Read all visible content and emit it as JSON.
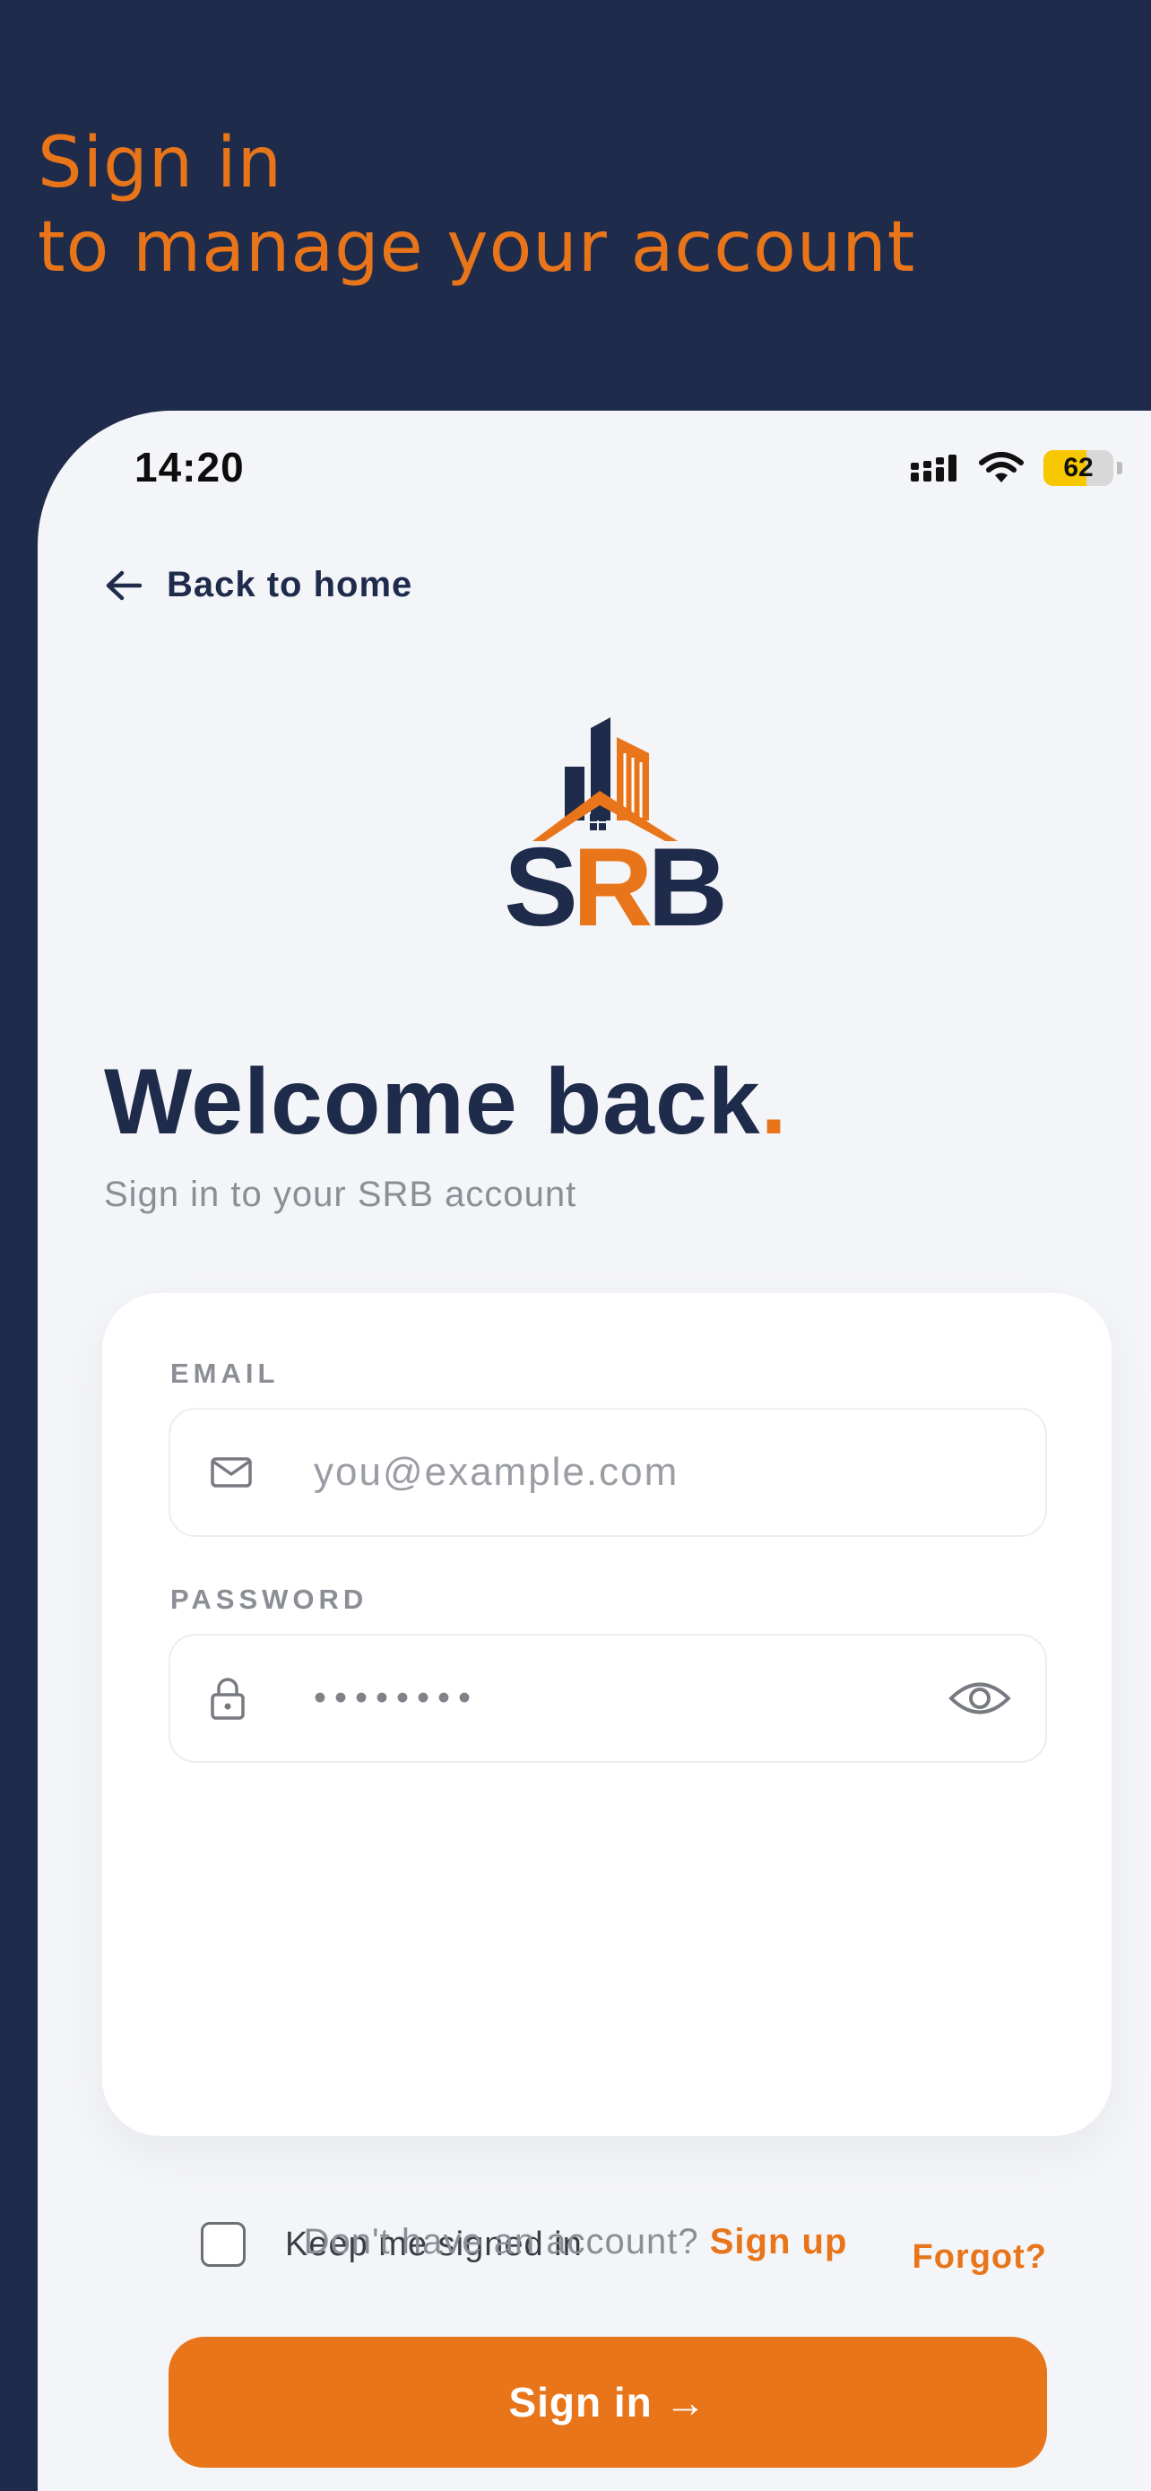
{
  "hero": {
    "line1": "Sign in",
    "line2": "to manage your account"
  },
  "status_bar": {
    "time": "14:20",
    "battery": "62",
    "battery_level": 0.62,
    "icons": [
      "signal-icon",
      "wifi-icon",
      "battery-icon"
    ]
  },
  "nav": {
    "back_label": "Back to home"
  },
  "brand": {
    "logo_text": "SRB",
    "navy": "#1f2b4b",
    "orange": "#e8751a"
  },
  "heading": {
    "title": "Welcome back",
    "dot": ".",
    "subtitle": "Sign in to your SRB account"
  },
  "form": {
    "email_label": "EMAIL",
    "email_placeholder": "you@example.com",
    "email_value": "",
    "password_label": "PASSWORD",
    "password_value": "••••••••",
    "remember_label": "Keep me signed in",
    "remember_checked": false,
    "forgot_label": "Forgot?",
    "submit_label": "Sign in →"
  },
  "footer": {
    "prompt": "Don't have an account? ",
    "signup_label": "Sign up"
  }
}
